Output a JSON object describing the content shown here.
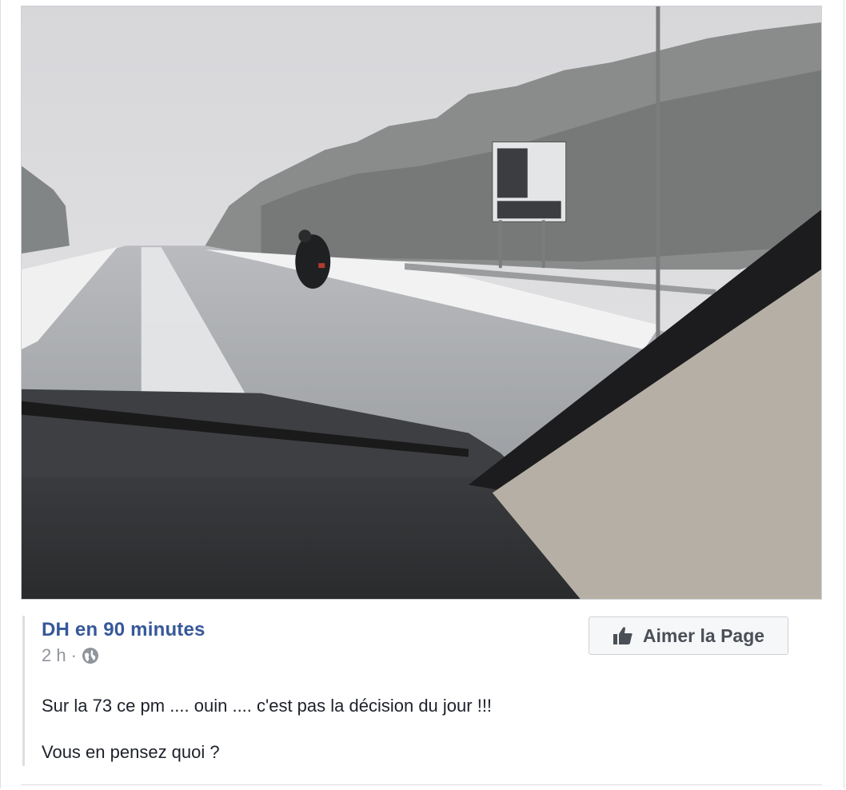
{
  "post": {
    "photo_icon": "road-photo",
    "page_name": "DH en 90 minutes",
    "timestamp": "2 h",
    "separator": "·",
    "privacy_icon": "globe-icon",
    "like_button": {
      "icon": "thumbs-up-icon",
      "label": "Aimer la Page"
    },
    "message_lines": [
      "Sur la 73 ce pm .... ouin .... c'est pas la décision du jour !!!",
      "Vous en pensez quoi ?"
    ]
  },
  "colors": {
    "link": "#365899",
    "meta": "#90949c",
    "text": "#1d2129",
    "border": "#dddfe2",
    "button_bg": "#f6f7f9"
  }
}
